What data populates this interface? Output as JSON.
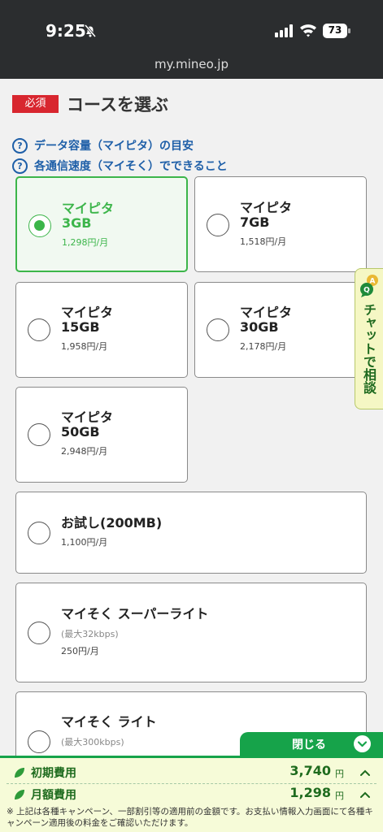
{
  "status_bar": {
    "time": "9:25",
    "battery": "73"
  },
  "browser": {
    "url": "my.mineo.jp"
  },
  "section": {
    "required_badge": "必須",
    "title": "コースを選ぶ"
  },
  "help_links": [
    {
      "label": "データ容量（マイピタ）の目安"
    },
    {
      "label": "各通信速度（マイそく）でできること"
    }
  ],
  "plans": [
    {
      "name": "マイピタ",
      "size": "3GB",
      "price": "1,298円/月",
      "selected": true
    },
    {
      "name": "マイピタ",
      "size": "7GB",
      "price": "1,518円/月",
      "selected": false
    },
    {
      "name": "マイピタ",
      "size": "15GB",
      "price": "1,958円/月",
      "selected": false
    },
    {
      "name": "マイピタ",
      "size": "30GB",
      "price": "2,178円/月",
      "selected": false
    },
    {
      "name": "マイピタ",
      "size": "50GB",
      "price": "2,948円/月",
      "selected": false
    },
    {
      "name": "お試し(200MB)",
      "price": "1,100円/月",
      "selected": false
    },
    {
      "name": "マイそく スーパーライト",
      "note": "(最大32kbps)",
      "price": "250円/月",
      "selected": false
    },
    {
      "name": "マイそく ライト",
      "note": "(最大300kbps)",
      "selected": false
    }
  ],
  "chat": {
    "label": "チャットで相談"
  },
  "summary": {
    "close_label": "閉じる",
    "initial_label": "初期費用",
    "initial_value": "3,740",
    "monthly_label": "月額費用",
    "monthly_value": "1,298",
    "yen": "円",
    "disclaimer": "※ 上記は各種キャンペーン、一部割引等の適用前の金額です。お支払い情報入力画面にて各種キャンペーン適用後の料金をご確認いただけます。"
  },
  "colors": {
    "accent_green": "#3cb54a",
    "brand_green": "#16a34a",
    "required_red": "#d8262f",
    "link_blue": "#1e5fa8"
  }
}
